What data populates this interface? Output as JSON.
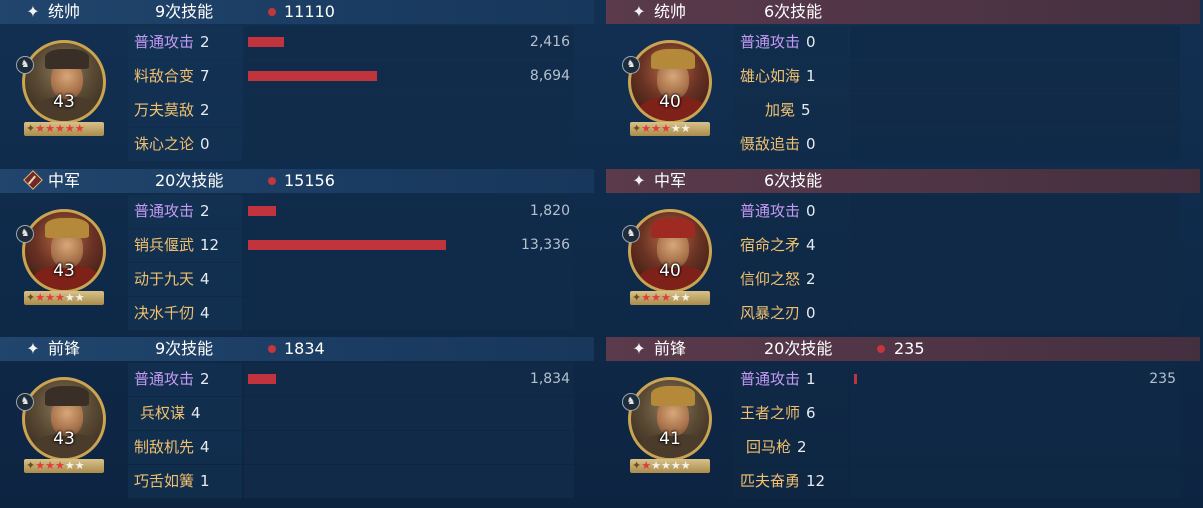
{
  "left": [
    {
      "role": "统帅",
      "role_icon": "sparkle-icon",
      "count": "9次技能",
      "total": "11110",
      "level": "43",
      "stars_on": 5,
      "stars_total": 5,
      "skills": [
        {
          "name": "普通攻击",
          "count": "2",
          "damage": "2,416",
          "bar_fraction": 0.11,
          "basic": true
        },
        {
          "name": "料敌合变",
          "count": "7",
          "damage": "8,694",
          "bar_fraction": 0.39
        },
        {
          "name": "万夫莫敌",
          "count": "2"
        },
        {
          "name": "诛心之论",
          "count": "0"
        }
      ]
    },
    {
      "role": "中军",
      "role_icon": "banner-diamond-icon",
      "count": "20次技能",
      "total": "15156",
      "level": "43",
      "stars_on": 3,
      "stars_total": 5,
      "skills": [
        {
          "name": "普通攻击",
          "count": "2",
          "damage": "1,820",
          "bar_fraction": 0.085,
          "basic": true
        },
        {
          "name": "销兵偃武",
          "count": "12",
          "damage": "13,336",
          "bar_fraction": 0.6
        },
        {
          "name": "动于九天",
          "count": "4"
        },
        {
          "name": "决水千仞",
          "count": "4"
        }
      ]
    },
    {
      "role": "前锋",
      "role_icon": "sparkle-icon",
      "count": "9次技能",
      "total": "1834",
      "level": "43",
      "stars_on": 3,
      "stars_total": 5,
      "skills": [
        {
          "name": "普通攻击",
          "count": "2",
          "damage": "1,834",
          "bar_fraction": 0.085,
          "basic": true
        },
        {
          "name": "兵权谋",
          "count": "4",
          "indent": 1
        },
        {
          "name": "制敌机先",
          "count": "4"
        },
        {
          "name": "巧舌如簧",
          "count": "1"
        }
      ]
    }
  ],
  "right": [
    {
      "role": "统帅",
      "role_icon": "sparkle-icon",
      "count": "6次技能",
      "total": "",
      "level": "40",
      "stars_on": 3,
      "stars_total": 5,
      "skills": [
        {
          "name": "普通攻击",
          "count": "0",
          "basic": true
        },
        {
          "name": "雄心如海",
          "count": "1"
        },
        {
          "name": "加冕",
          "count": "5",
          "indent": 2
        },
        {
          "name": "慑敌追击",
          "count": "0"
        }
      ]
    },
    {
      "role": "中军",
      "role_icon": "sparkle-icon",
      "count": "6次技能",
      "total": "",
      "level": "40",
      "stars_on": 3,
      "stars_total": 5,
      "skills": [
        {
          "name": "普通攻击",
          "count": "0",
          "basic": true
        },
        {
          "name": "宿命之矛",
          "count": "4"
        },
        {
          "name": "信仰之怒",
          "count": "2"
        },
        {
          "name": "风暴之刃",
          "count": "0"
        }
      ]
    },
    {
      "role": "前锋",
      "role_icon": "sparkle-icon",
      "count": "20次技能",
      "total": "235",
      "level": "41",
      "stars_on": 1,
      "stars_total": 5,
      "skills": [
        {
          "name": "普通攻击",
          "count": "1",
          "damage": "235",
          "bar_fraction": 0.01,
          "basic": true
        },
        {
          "name": "王者之师",
          "count": "6"
        },
        {
          "name": "回马枪",
          "count": "2",
          "indent": 1
        },
        {
          "name": "匹夫奋勇",
          "count": "12"
        }
      ]
    }
  ],
  "colors": {
    "left_header": "#21456d",
    "right_header": "#5a3a4b",
    "bar": "#c1343d",
    "skill_name": "#f0c070",
    "basic_skill_name": "#c49af2",
    "star_on": "#e23b3b"
  }
}
